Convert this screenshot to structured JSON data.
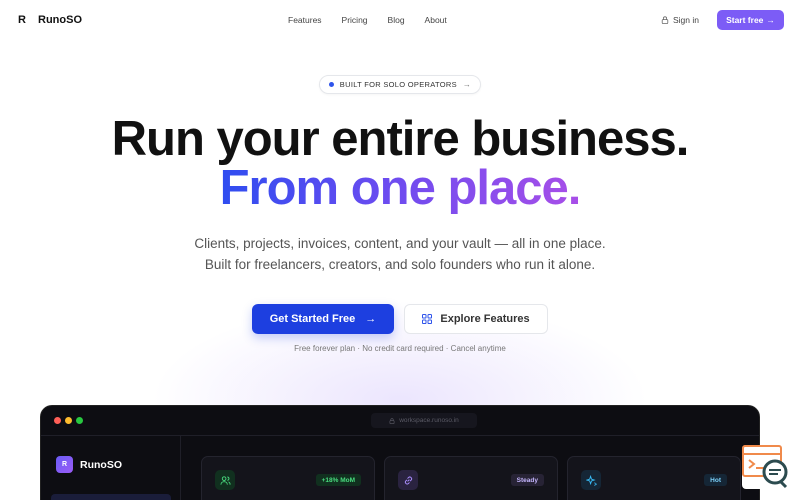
{
  "nav": {
    "brand_mark": "R",
    "brand_name": "RunoSO",
    "links": [
      "Features",
      "Pricing",
      "Blog",
      "About"
    ],
    "signin": "Sign in",
    "start_label": "Start free",
    "start_arrow": "→"
  },
  "badge": {
    "text": "BUILT FOR SOLO OPERATORS",
    "arrow": "→"
  },
  "hero": {
    "line1": "Run your entire business.",
    "line2": "From one place.",
    "subtitle_1": "Clients, projects, invoices, content, and your vault — all in one place.",
    "subtitle_2": "Built for freelancers, creators, and solo founders who run it alone."
  },
  "cta": {
    "primary_label": "Get Started Free",
    "primary_arrow": "→",
    "secondary_label": "Explore Features",
    "fine_print": "Free forever plan · No credit card required · Cancel anytime"
  },
  "preview": {
    "url": "workspace.runoso.in",
    "side_logo": "R",
    "side_name": "RunoSO",
    "cards": [
      {
        "icon": "users-icon",
        "tag": "+18% MoM",
        "tag_color": "#4ade80",
        "tag_bg": "#11301f",
        "icon_bg": "#11301f",
        "icon_color": "#4ade80"
      },
      {
        "icon": "link-icon",
        "tag": "Steady",
        "tag_color": "#c4b5fd",
        "tag_bg": "#272335",
        "icon_bg": "#2a2340",
        "icon_color": "#a78bfa"
      },
      {
        "icon": "sparkle-icon",
        "tag": "Hot",
        "tag_color": "#7dd3fc",
        "tag_bg": "#152636",
        "icon_bg": "#152636",
        "icon_color": "#38bdf8"
      }
    ]
  },
  "colors": {
    "accent": "#7c5cf6",
    "primary_blue": "#1d3fe0",
    "gradient_start": "#2f4df0",
    "gradient_end": "#a84ee8"
  }
}
